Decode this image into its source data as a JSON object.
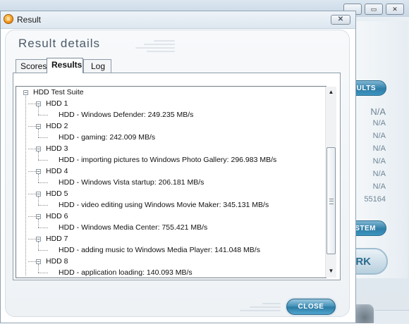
{
  "background_window": {
    "buttons": [
      "ESULTS",
      "YSTEM",
      "ARK"
    ],
    "values": [
      "N/A",
      "N/A",
      "N/A",
      "N/A",
      "N/A",
      "N/A",
      "N/A",
      "55164"
    ]
  },
  "dialog": {
    "title": "Result",
    "close_glyph": "✕",
    "heading": "Result details",
    "tabs": [
      "Scores",
      "Results",
      "Log"
    ],
    "active_tab": "Results",
    "tree": {
      "root": "HDD Test Suite",
      "groups": [
        {
          "label": "HDD 1",
          "child": "HDD - Windows Defender: 249.235 MB/s"
        },
        {
          "label": "HDD 2",
          "child": "HDD - gaming: 242.009 MB/s"
        },
        {
          "label": "HDD 3",
          "child": "HDD - importing pictures to Windows Photo Gallery: 296.983 MB/s"
        },
        {
          "label": "HDD 4",
          "child": "HDD - Windows Vista startup: 206.181 MB/s"
        },
        {
          "label": "HDD 5",
          "child": "HDD - video editing using Windows Movie Maker: 345.131 MB/s"
        },
        {
          "label": "HDD 6",
          "child": "HDD - Windows Media Center: 755.421 MB/s"
        },
        {
          "label": "HDD 7",
          "child": "HDD - adding music to Windows Media Player: 141.048 MB/s"
        },
        {
          "label": "HDD 8",
          "child": "HDD - application loading: 140.093 MB/s"
        }
      ]
    },
    "close_button": "CLOSE"
  },
  "icons": {
    "app": "result-app-icon",
    "expanded": "minus-icon",
    "scroll_up": "scroll-up-arrow-icon",
    "scroll_down": "scroll-down-arrow-icon"
  },
  "colors": {
    "accent": "#3c8db6",
    "heading": "#4c5b68",
    "background_values": "#6e8596"
  }
}
